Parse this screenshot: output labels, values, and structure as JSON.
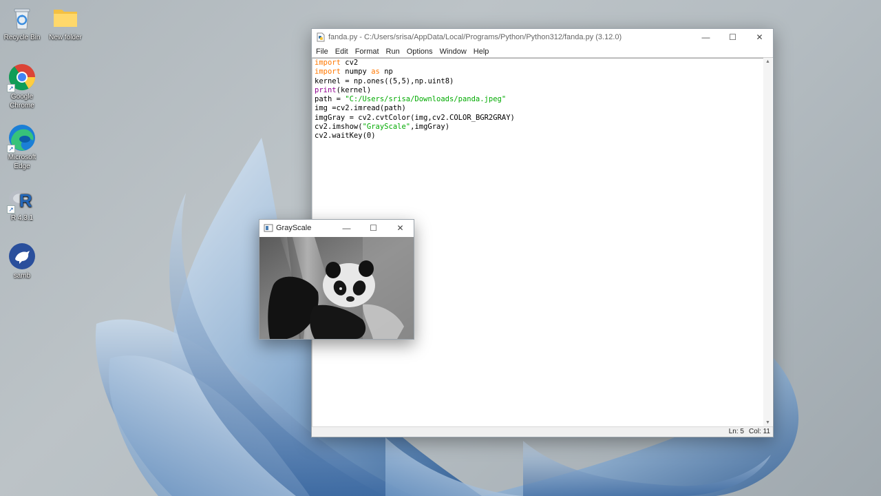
{
  "desktop": {
    "icons": [
      {
        "label": "Recycle Bin"
      },
      {
        "label": "New folder"
      },
      {
        "label": "Google Chrome"
      },
      {
        "label": "Microsoft Edge"
      },
      {
        "label": "R 4.3.1"
      },
      {
        "label": "samb"
      }
    ],
    "r_icon_letter": "R"
  },
  "idle_window": {
    "title": "fanda.py - C:/Users/srisa/AppData/Local/Programs/Python/Python312/fanda.py (3.12.0)",
    "menu": [
      "File",
      "Edit",
      "Format",
      "Run",
      "Options",
      "Window",
      "Help"
    ],
    "code_lines": [
      "import cv2",
      "import numpy as np",
      "kernel = np.ones((5,5),np.uint8)",
      "print(kernel)",
      "path = \"C:/Users/srisa/Downloads/panda.jpeg\"",
      "img =cv2.imread(path)",
      "imgGray = cv2.cvtColor(img,cv2.COLOR_BGR2GRAY)",
      "cv2.imshow(\"GrayScale\",imgGray)",
      "cv2.waitKey(0)"
    ],
    "status": {
      "line": "Ln: 5",
      "col": "Col: 11"
    },
    "syntax_colors": {
      "keyword": "#ff7700",
      "builtin": "#900090",
      "string": "#00aa00"
    }
  },
  "gray_window": {
    "title": "GrayScale"
  },
  "window_controls": {
    "minimize": "—",
    "maximize": "☐",
    "close": "✕"
  }
}
